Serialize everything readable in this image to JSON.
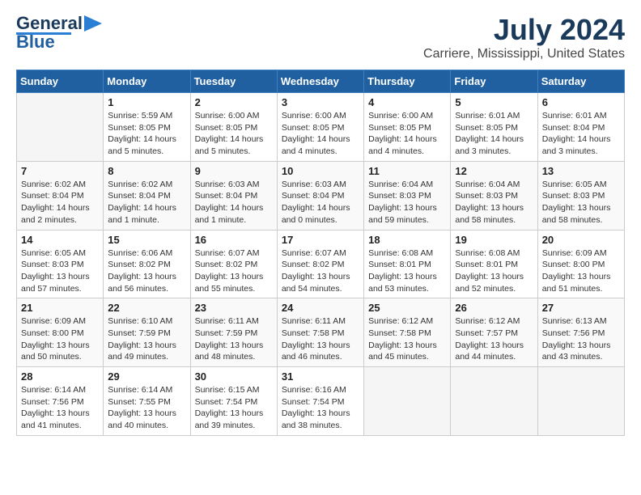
{
  "header": {
    "logo_line1": "General",
    "logo_line2": "Blue",
    "title": "July 2024",
    "subtitle": "Carriere, Mississippi, United States"
  },
  "calendar": {
    "days_of_week": [
      "Sunday",
      "Monday",
      "Tuesday",
      "Wednesday",
      "Thursday",
      "Friday",
      "Saturday"
    ],
    "weeks": [
      [
        {
          "day": "",
          "info": ""
        },
        {
          "day": "1",
          "info": "Sunrise: 5:59 AM\nSunset: 8:05 PM\nDaylight: 14 hours\nand 5 minutes."
        },
        {
          "day": "2",
          "info": "Sunrise: 6:00 AM\nSunset: 8:05 PM\nDaylight: 14 hours\nand 5 minutes."
        },
        {
          "day": "3",
          "info": "Sunrise: 6:00 AM\nSunset: 8:05 PM\nDaylight: 14 hours\nand 4 minutes."
        },
        {
          "day": "4",
          "info": "Sunrise: 6:00 AM\nSunset: 8:05 PM\nDaylight: 14 hours\nand 4 minutes."
        },
        {
          "day": "5",
          "info": "Sunrise: 6:01 AM\nSunset: 8:05 PM\nDaylight: 14 hours\nand 3 minutes."
        },
        {
          "day": "6",
          "info": "Sunrise: 6:01 AM\nSunset: 8:04 PM\nDaylight: 14 hours\nand 3 minutes."
        }
      ],
      [
        {
          "day": "7",
          "info": "Sunrise: 6:02 AM\nSunset: 8:04 PM\nDaylight: 14 hours\nand 2 minutes."
        },
        {
          "day": "8",
          "info": "Sunrise: 6:02 AM\nSunset: 8:04 PM\nDaylight: 14 hours\nand 1 minute."
        },
        {
          "day": "9",
          "info": "Sunrise: 6:03 AM\nSunset: 8:04 PM\nDaylight: 14 hours\nand 1 minute."
        },
        {
          "day": "10",
          "info": "Sunrise: 6:03 AM\nSunset: 8:04 PM\nDaylight: 14 hours\nand 0 minutes."
        },
        {
          "day": "11",
          "info": "Sunrise: 6:04 AM\nSunset: 8:03 PM\nDaylight: 13 hours\nand 59 minutes."
        },
        {
          "day": "12",
          "info": "Sunrise: 6:04 AM\nSunset: 8:03 PM\nDaylight: 13 hours\nand 58 minutes."
        },
        {
          "day": "13",
          "info": "Sunrise: 6:05 AM\nSunset: 8:03 PM\nDaylight: 13 hours\nand 58 minutes."
        }
      ],
      [
        {
          "day": "14",
          "info": "Sunrise: 6:05 AM\nSunset: 8:03 PM\nDaylight: 13 hours\nand 57 minutes."
        },
        {
          "day": "15",
          "info": "Sunrise: 6:06 AM\nSunset: 8:02 PM\nDaylight: 13 hours\nand 56 minutes."
        },
        {
          "day": "16",
          "info": "Sunrise: 6:07 AM\nSunset: 8:02 PM\nDaylight: 13 hours\nand 55 minutes."
        },
        {
          "day": "17",
          "info": "Sunrise: 6:07 AM\nSunset: 8:02 PM\nDaylight: 13 hours\nand 54 minutes."
        },
        {
          "day": "18",
          "info": "Sunrise: 6:08 AM\nSunset: 8:01 PM\nDaylight: 13 hours\nand 53 minutes."
        },
        {
          "day": "19",
          "info": "Sunrise: 6:08 AM\nSunset: 8:01 PM\nDaylight: 13 hours\nand 52 minutes."
        },
        {
          "day": "20",
          "info": "Sunrise: 6:09 AM\nSunset: 8:00 PM\nDaylight: 13 hours\nand 51 minutes."
        }
      ],
      [
        {
          "day": "21",
          "info": "Sunrise: 6:09 AM\nSunset: 8:00 PM\nDaylight: 13 hours\nand 50 minutes."
        },
        {
          "day": "22",
          "info": "Sunrise: 6:10 AM\nSunset: 7:59 PM\nDaylight: 13 hours\nand 49 minutes."
        },
        {
          "day": "23",
          "info": "Sunrise: 6:11 AM\nSunset: 7:59 PM\nDaylight: 13 hours\nand 48 minutes."
        },
        {
          "day": "24",
          "info": "Sunrise: 6:11 AM\nSunset: 7:58 PM\nDaylight: 13 hours\nand 46 minutes."
        },
        {
          "day": "25",
          "info": "Sunrise: 6:12 AM\nSunset: 7:58 PM\nDaylight: 13 hours\nand 45 minutes."
        },
        {
          "day": "26",
          "info": "Sunrise: 6:12 AM\nSunset: 7:57 PM\nDaylight: 13 hours\nand 44 minutes."
        },
        {
          "day": "27",
          "info": "Sunrise: 6:13 AM\nSunset: 7:56 PM\nDaylight: 13 hours\nand 43 minutes."
        }
      ],
      [
        {
          "day": "28",
          "info": "Sunrise: 6:14 AM\nSunset: 7:56 PM\nDaylight: 13 hours\nand 41 minutes."
        },
        {
          "day": "29",
          "info": "Sunrise: 6:14 AM\nSunset: 7:55 PM\nDaylight: 13 hours\nand 40 minutes."
        },
        {
          "day": "30",
          "info": "Sunrise: 6:15 AM\nSunset: 7:54 PM\nDaylight: 13 hours\nand 39 minutes."
        },
        {
          "day": "31",
          "info": "Sunrise: 6:16 AM\nSunset: 7:54 PM\nDaylight: 13 hours\nand 38 minutes."
        },
        {
          "day": "",
          "info": ""
        },
        {
          "day": "",
          "info": ""
        },
        {
          "day": "",
          "info": ""
        }
      ]
    ]
  }
}
